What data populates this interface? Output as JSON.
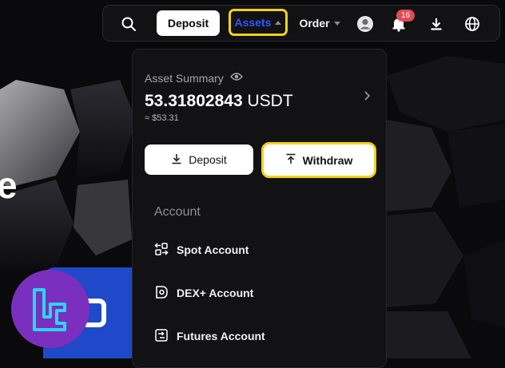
{
  "navbar": {
    "search_icon": "search-icon",
    "deposit_label": "Deposit",
    "assets_label": "Assets",
    "order_label": "Order",
    "notification_count": "16",
    "icons": [
      "avatar-icon",
      "bell-icon",
      "download-icon",
      "globe-icon"
    ]
  },
  "dropdown": {
    "summary_label": "Asset Summary",
    "balance_value": "53.31802843",
    "balance_currency": "USDT",
    "fiat_value": "≈ $53.31",
    "deposit_label": "Deposit",
    "withdraw_label": "Withdraw",
    "section_title": "Account",
    "items": [
      {
        "label": "Spot Account",
        "icon": "transfer-icon"
      },
      {
        "label": "DEX+ Account",
        "icon": "dex-icon"
      },
      {
        "label": "Futures Account",
        "icon": "futures-icon"
      }
    ]
  },
  "background": {
    "partial_text": "e"
  },
  "colors": {
    "highlight": "#f2d21b",
    "assets_blue": "#2f55ff",
    "badge": "#e24a57",
    "logo_purple": "#7b2fbe"
  }
}
